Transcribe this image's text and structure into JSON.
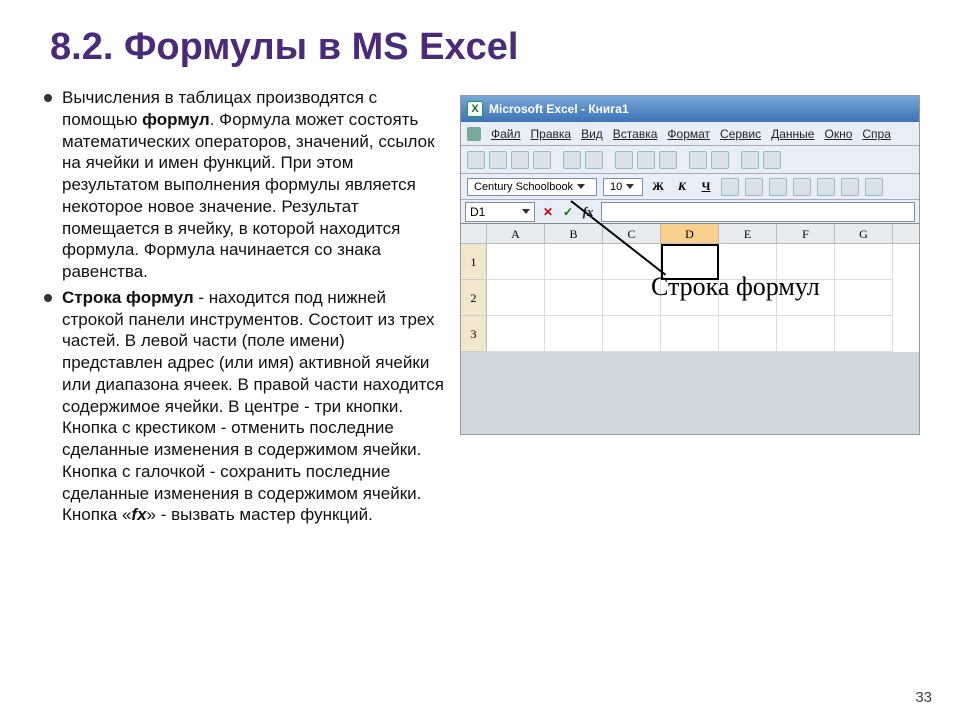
{
  "title": "8.2. Формулы в MS Excel",
  "bullets": {
    "item1_pre": "Вычисления в таблицах производятся с помощью ",
    "item1_bold": "формул",
    "item1_post": ". Формула может состоять математических операторов, значений, ссылок на ячейки и имен функций. При этом результатом выполнения формулы является некоторое новое значение. Результат помещается в ячейку, в которой находится формула. Формула начинается со знака равенства.",
    "item2_bold": "Строка формул",
    "item2_mid": " - находится под нижней строкой панели инструментов. Состоит из трех частей. В левой части (поле имени) представлен адрес (или имя) активной ячейки или диапазона ячеек. В правой части находится содержимое ячейки. В центре - три кнопки. Кнопка с крестиком - отменить последние сделанные изменения в содержимом ячейки. Кнопка с галочкой - сохранить последние сделанные изменения в содержимом ячейки. Кнопка «",
    "item2_fx": "fx",
    "item2_end": "» - вызвать мастер функций."
  },
  "excel": {
    "app_icon": "X",
    "title": "Microsoft Excel - Книга1",
    "menus": [
      "Файл",
      "Правка",
      "Вид",
      "Вставка",
      "Формат",
      "Сервис",
      "Данные",
      "Окно",
      "Спра"
    ],
    "font_name": "Century Schoolbook",
    "font_size": "10",
    "fmt_bold": "Ж",
    "fmt_italic": "К",
    "fmt_underline": "Ч",
    "namebox": "D1",
    "fx_cancel": "✕",
    "fx_ok": "✓",
    "fx_label": "fx",
    "columns": [
      "A",
      "B",
      "C",
      "D",
      "E",
      "F",
      "G"
    ],
    "rows": [
      "1",
      "2",
      "3"
    ],
    "annotation": "Строка формул"
  },
  "page_number": "33"
}
